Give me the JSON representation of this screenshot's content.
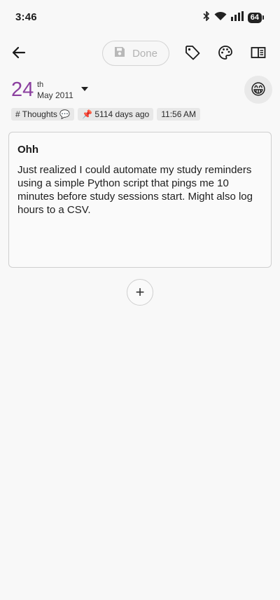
{
  "status_bar": {
    "time": "3:46",
    "battery": "64",
    "icons": [
      "bluetooth-icon",
      "wifi-icon",
      "signal-icon",
      "battery-icon"
    ]
  },
  "toolbar": {
    "back_icon": "arrow-left-icon",
    "done_label": "Done",
    "done_icon": "save-icon",
    "tag_icon": "tag-icon",
    "palette_icon": "palette-icon",
    "sidebar_icon": "side-panel-icon"
  },
  "entry_date": {
    "day": "24",
    "ordinal": "th",
    "month_year": "May 2011"
  },
  "mood": {
    "emoji": "😁"
  },
  "chips": {
    "category": "# Thoughts 💬",
    "pin": "📌 5114 days ago",
    "time": "11:56 AM"
  },
  "entry": {
    "title": "Ohh",
    "body": "Just realized I could automate my study reminders using a simple Python script that pings me 10 minutes before study sessions start. Might also log hours to a CSV."
  },
  "add_button": {
    "symbol": "+"
  },
  "colors": {
    "accent_date": "#8b3f9f",
    "background": "#f8f8f8"
  }
}
